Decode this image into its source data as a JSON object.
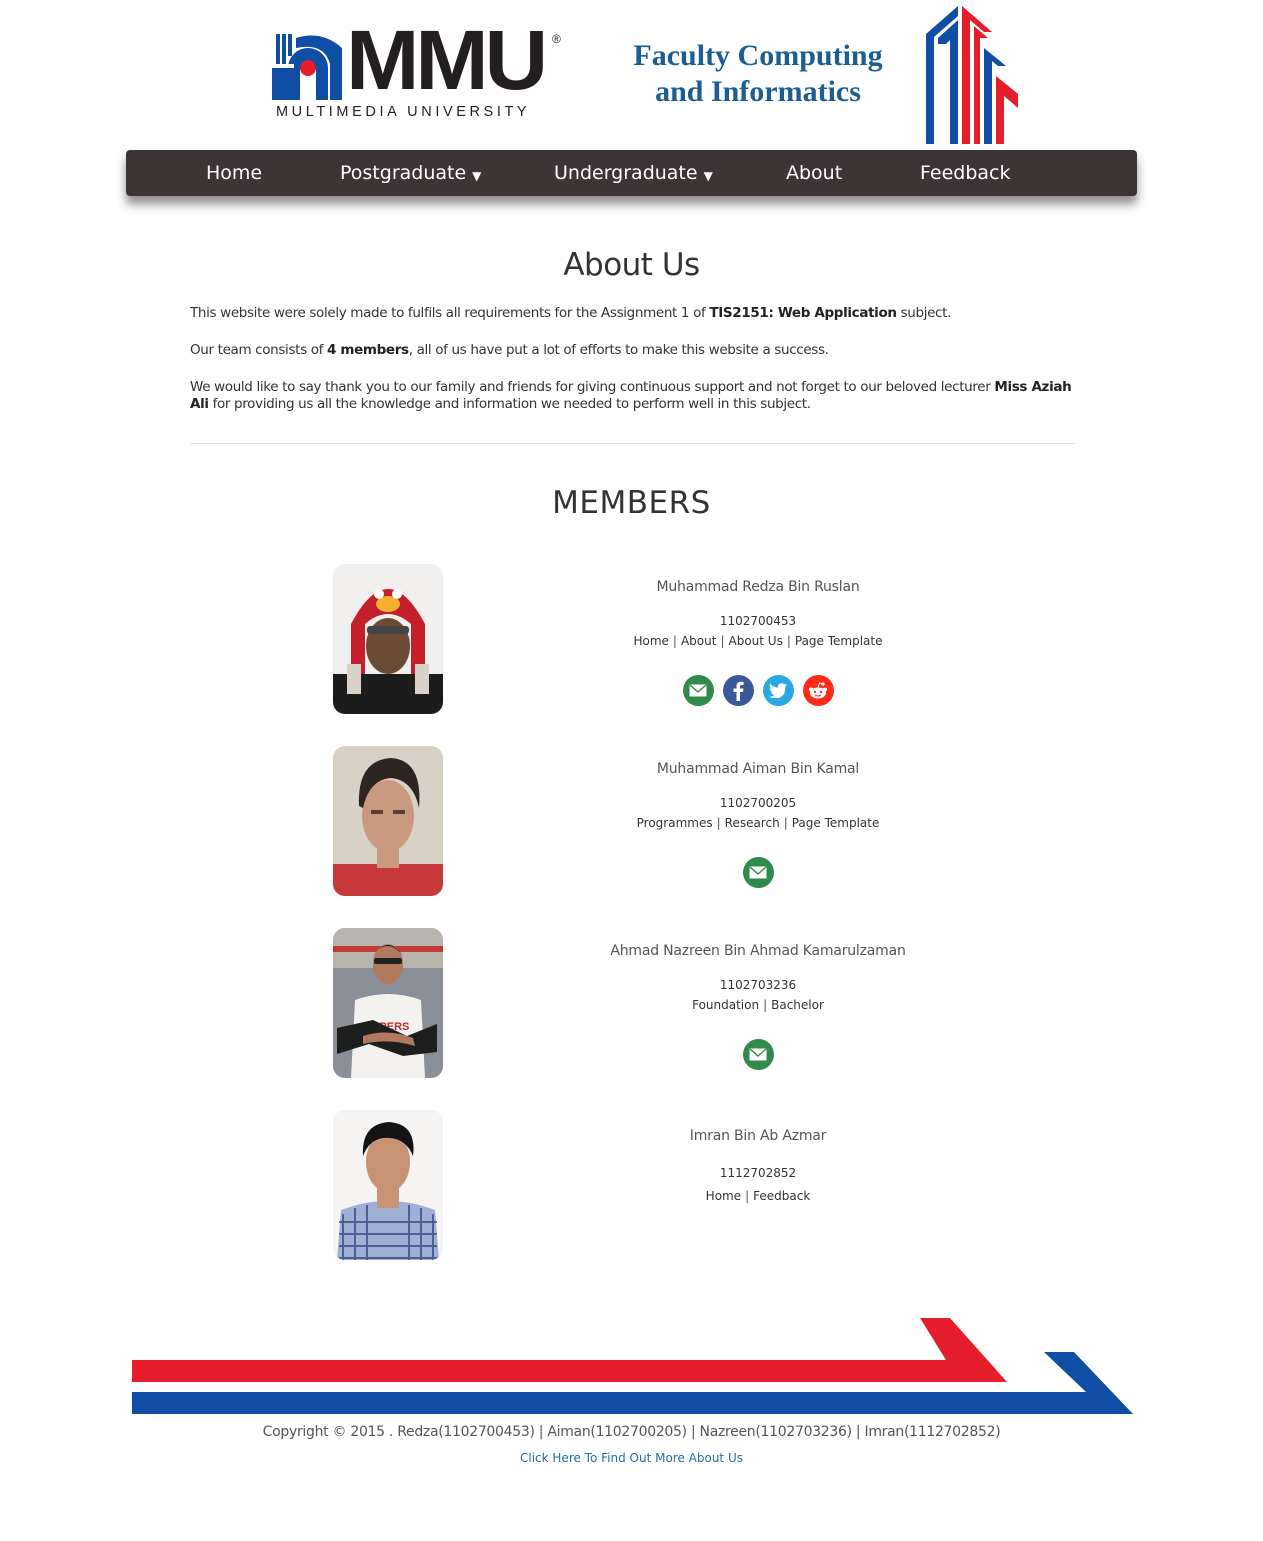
{
  "brand": {
    "logo_text": "MMU",
    "logo_reg": "®",
    "logo_sub": "MULTIMEDIA UNIVERSITY",
    "faculty_line1": "Faculty Computing",
    "faculty_line2": "and Informatics",
    "colors": {
      "blue": "#0f4ea4",
      "red": "#e61e2b",
      "faculty_text": "#1c5e92",
      "nav_bg": "#3c3435"
    }
  },
  "nav": {
    "home": "Home",
    "postgraduate": "Postgraduate",
    "undergraduate": "Undergraduate",
    "about": "About",
    "feedback": "Feedback",
    "caret": "▼"
  },
  "about": {
    "title": "About Us",
    "p1_a": "This website were solely made to fulfils all requirements for the Assignment 1 of ",
    "p1_b": "TIS2151: Web Application",
    "p1_c": " subject.",
    "p2_a": "Our team consists of ",
    "p2_b": "4 members",
    "p2_c": ", all of us have put a lot of efforts to make this website a success.",
    "p3_a": "We would like to say thank you to our family and friends for giving continuous support and not forget to our beloved lecturer ",
    "p3_b": "Miss Aziah Ali",
    "p3_c": " for providing us all the knowledge and information we needed to perform well in this subject."
  },
  "members_title": "MEMBERS",
  "members": [
    {
      "name": "Muhammad Redza Bin Ruslan",
      "id": "1102700453",
      "links": [
        "Home",
        "About",
        "About Us",
        "Page Template"
      ],
      "socials": [
        "email-icon",
        "facebook-icon",
        "twitter-icon",
        "reddit-icon"
      ]
    },
    {
      "name": "Muhammad Aiman Bin Kamal",
      "id": "1102700205",
      "links": [
        "Programmes",
        "Research",
        "Page Template"
      ],
      "socials": [
        "email-icon"
      ]
    },
    {
      "name": "Ahmad Nazreen Bin Ahmad Kamarulzaman",
      "id": "1102703236",
      "links": [
        "Foundation",
        "Bachelor"
      ],
      "socials": [
        "email-icon"
      ]
    },
    {
      "name": "Imran Bin Ab Azmar",
      "id": "1112702852",
      "links": [
        "Home",
        "Feedback"
      ],
      "socials": []
    }
  ],
  "social_colors": {
    "email": "#2f8a4b",
    "facebook": "#3b5998",
    "twitter": "#2aa9e0",
    "reddit": "#ff2a1a"
  },
  "footer": {
    "copyright": "Copyright © 2015 . Redza(1102700453) | Aiman(1102700205) | Nazreen(1102703236) | Imran(1112702852)",
    "more_link": "Click Here To Find Out More About Us"
  }
}
